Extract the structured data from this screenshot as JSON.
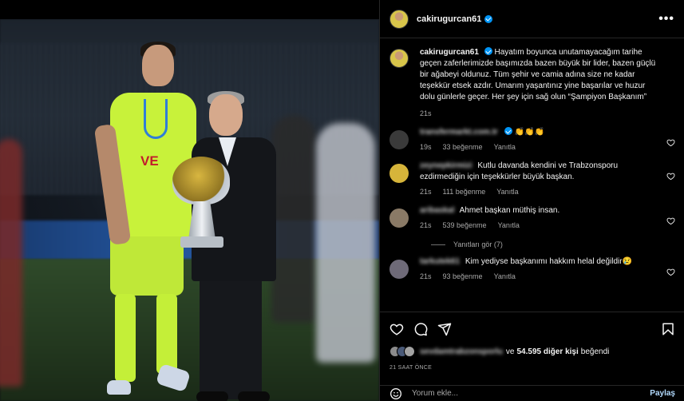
{
  "post": {
    "username": "cakirugurcan61",
    "more_label": "•••"
  },
  "caption": {
    "username": "cakirugurcan61",
    "text": "Hayatım boyunca unutamayacağım tarihe geçen zaferlerimizde başımızda bazen büyük bir lider, bazen güçlü bir ağabeyi oldunuz. Tüm şehir ve camia adına size ne kadar teşekkür etsek azdır. Umarım yaşantınız yine başarılar ve huzur dolu günlerle geçer. Her şey için sağ olun “Şampiyon Başkanım”",
    "time": "21s"
  },
  "comments": [
    {
      "username": "transfermarkt.com.tr",
      "verified": true,
      "text": "👏👏👏",
      "time": "19s",
      "likes": "33 beğenme",
      "reply": "Yanıtla",
      "avatar_color": "#3a3a3a"
    },
    {
      "username": "zeynepkirmizi",
      "verified": false,
      "text": "Kutlu davanda kendini ve Trabzonsporu ezdirmediğin için teşekkürler büyük başkan.",
      "time": "21s",
      "likes": "111 beğenme",
      "reply": "Yanıtla",
      "avatar_color": "#d6b43a"
    },
    {
      "username": "aribaskal",
      "verified": false,
      "text": "Ahmet başkan müthiş insan.",
      "time": "21s",
      "likes": "539 beğenme",
      "reply": "Yanıtla",
      "avatar_color": "#8a7a66"
    },
    {
      "username": "tarkutek61",
      "verified": false,
      "text": "Kim yediyse başkanımı hakkım helal değildir😢",
      "time": "21s",
      "likes": "93 beğenme",
      "reply": "Yanıtla",
      "avatar_color": "#6e6a78"
    }
  ],
  "replies_label": "Yanıtları gör (7)",
  "likes": {
    "liked_by": "sevdamtrabzonsporlu",
    "connector": "ve",
    "count": "54.595 diğer kişi",
    "suffix": "beğendi"
  },
  "post_time": "21 SAAT ÖNCE",
  "add_comment": {
    "placeholder": "Yorum ekle...",
    "post_label": "Paylaş"
  },
  "photo": {
    "sponsor_text": "VE"
  },
  "colors": {
    "verified": "#0095f6",
    "jersey": "#c8f23a",
    "post_link": "#b3dbff"
  }
}
